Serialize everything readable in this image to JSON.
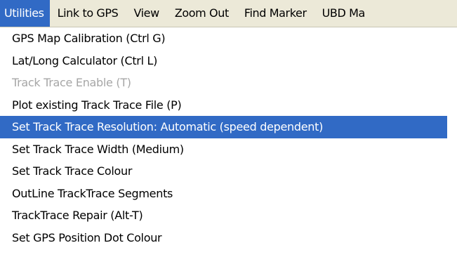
{
  "menubar": {
    "items": [
      {
        "label": "Utilities"
      },
      {
        "label": "Link to GPS"
      },
      {
        "label": "View"
      },
      {
        "label": "Zoom Out"
      },
      {
        "label": "Find Marker"
      },
      {
        "label": "UBD Ma"
      }
    ]
  },
  "dropdown": {
    "items": [
      {
        "label": "GPS Map Calibration (Ctrl G)"
      },
      {
        "label": "Lat/Long Calculator (Ctrl L)"
      },
      {
        "label": "Track Trace Enable (T)"
      },
      {
        "label": "Plot existing Track Trace File (P)"
      },
      {
        "label": "Set Track Trace Resolution:  Automatic (speed dependent)"
      },
      {
        "label": "Set Track Trace Width   (Medium)"
      },
      {
        "label": "Set Track Trace  Colour"
      },
      {
        "label": "OutLine TrackTrace Segments"
      },
      {
        "label": "TrackTrace Repair (Alt-T)"
      },
      {
        "label": "Set GPS Position Dot Colour"
      }
    ]
  },
  "colors": {
    "menubar_bg": "#ece9d8",
    "highlight": "#316ac5",
    "disabled_text": "#a6a6a6"
  }
}
